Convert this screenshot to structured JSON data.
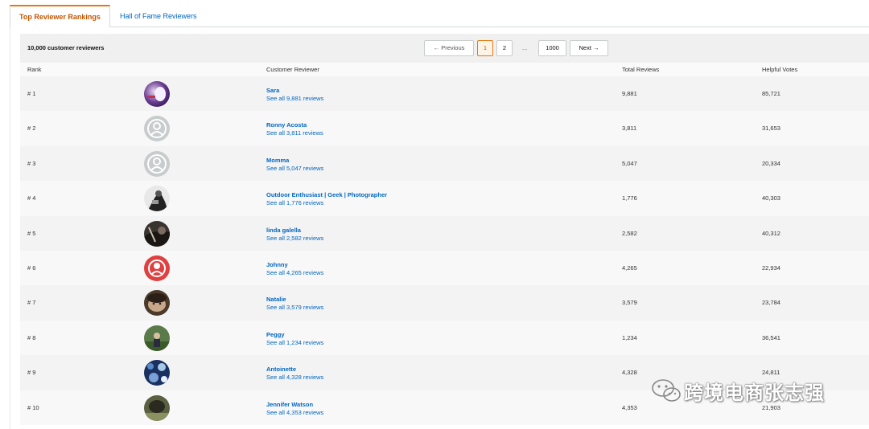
{
  "tabs": {
    "top_reviewer": "Top Reviewer Rankings",
    "hall_of_fame": "Hall of Fame Reviewers"
  },
  "header": {
    "count": "10,000 customer reviewers"
  },
  "pagination": {
    "previous": "← Previous",
    "next": "Next →",
    "pages": [
      "1",
      "2",
      "...",
      "1000"
    ],
    "current": "1"
  },
  "columns": {
    "rank": "Rank",
    "reviewer": "Customer Reviewer",
    "total": "Total Reviews",
    "votes": "Helpful Votes"
  },
  "rows": [
    {
      "rank": "# 1",
      "name": "Sara",
      "link": "See all 9,881 reviews",
      "total": "9,881",
      "votes": "85,721",
      "avatar": "photo-purple"
    },
    {
      "rank": "# 2",
      "name": "Ronny Acosta",
      "link": "See all 3,811 reviews",
      "total": "3,811",
      "votes": "31,653",
      "avatar": "default-person"
    },
    {
      "rank": "# 3",
      "name": "Momma",
      "link": "See all 5,047 reviews",
      "total": "5,047",
      "votes": "20,334",
      "avatar": "default-person"
    },
    {
      "rank": "# 4",
      "name": "Outdoor Enthusiast | Geek | Photographer",
      "link": "See all 1,776 reviews",
      "total": "1,776",
      "votes": "40,303",
      "avatar": "photo-bw"
    },
    {
      "rank": "# 5",
      "name": "linda galella",
      "link": "See all 2,582 reviews",
      "total": "2,582",
      "votes": "40,312",
      "avatar": "photo-dark"
    },
    {
      "rank": "# 6",
      "name": "Johnny",
      "link": "See all 4,265 reviews",
      "total": "4,265",
      "votes": "22,934",
      "avatar": "red-badge"
    },
    {
      "rank": "# 7",
      "name": "Natalie",
      "link": "See all 3,579 reviews",
      "total": "3,579",
      "votes": "23,784",
      "avatar": "photo-portrait"
    },
    {
      "rank": "# 8",
      "name": "Peggy",
      "link": "See all 1,234 reviews",
      "total": "1,234",
      "votes": "36,541",
      "avatar": "photo-green"
    },
    {
      "rank": "# 9",
      "name": "Antoinette",
      "link": "See all 4,328 reviews",
      "total": "4,328",
      "votes": "24,811",
      "avatar": "photo-blue"
    },
    {
      "rank": "# 10",
      "name": "Jennifer Watson",
      "link": "See all 4,353 reviews",
      "total": "4,353",
      "votes": "21,903",
      "avatar": "photo-olive"
    }
  ],
  "watermark": {
    "text": "跨境电商张志强",
    "icon": "wechat-icon"
  },
  "colors": {
    "accent_orange": "#e47911",
    "link_blue": "#0066c0",
    "row_odd": "#f3f3f3",
    "row_even": "#f8f8f8"
  }
}
